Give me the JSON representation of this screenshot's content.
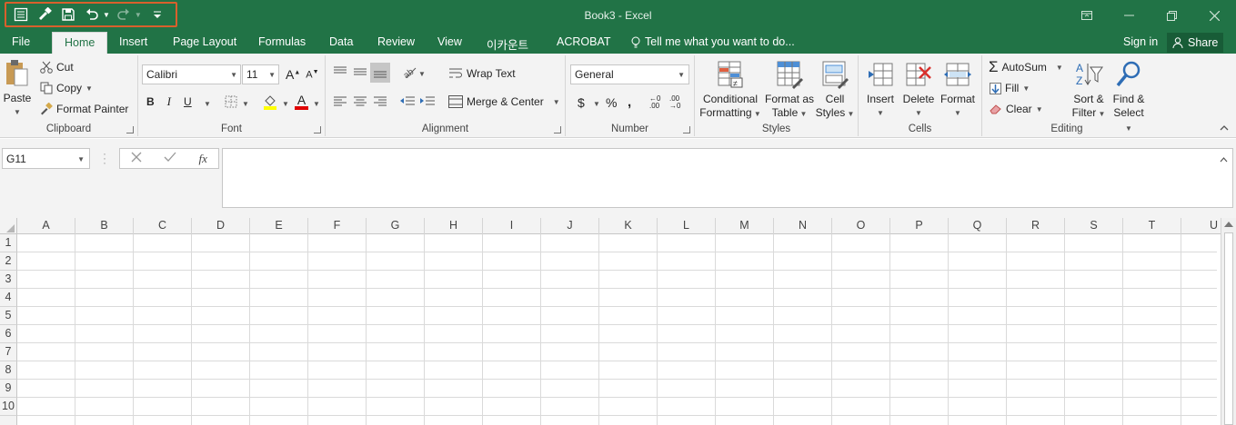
{
  "window": {
    "title": "Book3 - Excel"
  },
  "tabs": [
    {
      "label": "File"
    },
    {
      "label": "Home"
    },
    {
      "label": "Insert"
    },
    {
      "label": "Page Layout"
    },
    {
      "label": "Formulas"
    },
    {
      "label": "Data"
    },
    {
      "label": "Review"
    },
    {
      "label": "View"
    },
    {
      "label": "이카운트"
    },
    {
      "label": "ACROBAT"
    }
  ],
  "tellme": "Tell me what you want to do...",
  "signin": "Sign in",
  "share": "Share",
  "clipboard": {
    "paste": "Paste",
    "cut": "Cut",
    "copy": "Copy",
    "format_painter": "Format Painter",
    "label": "Clipboard"
  },
  "font": {
    "name": "Calibri",
    "size": "11",
    "bold": "B",
    "italic": "I",
    "underline": "U",
    "font_color_glyph": "A",
    "label": "Font"
  },
  "alignment": {
    "wrap": "Wrap Text",
    "merge": "Merge & Center",
    "label": "Alignment"
  },
  "number": {
    "format": "General",
    "label": "Number"
  },
  "styles": {
    "cond1": "Conditional",
    "cond2": "Formatting",
    "fmt1": "Format as",
    "fmt2": "Table",
    "cell1": "Cell",
    "cell2": "Styles",
    "label": "Styles"
  },
  "cells": {
    "insert": "Insert",
    "delete": "Delete",
    "format": "Format",
    "label": "Cells"
  },
  "editing": {
    "autosum": "AutoSum",
    "fill": "Fill",
    "clear": "Clear",
    "sort1": "Sort &",
    "sort2": "Filter",
    "find1": "Find &",
    "find2": "Select",
    "label": "Editing"
  },
  "namebox": "G11",
  "columns": [
    "A",
    "B",
    "C",
    "D",
    "E",
    "F",
    "G",
    "H",
    "I",
    "J",
    "K",
    "L",
    "M",
    "N",
    "O",
    "P",
    "Q",
    "R",
    "S",
    "T",
    "U"
  ],
  "rows": [
    "1",
    "2",
    "3",
    "4",
    "5",
    "6",
    "7",
    "8",
    "9",
    "10"
  ],
  "colors": {
    "accent": "#217346",
    "highlight_box": "#d9602c"
  }
}
